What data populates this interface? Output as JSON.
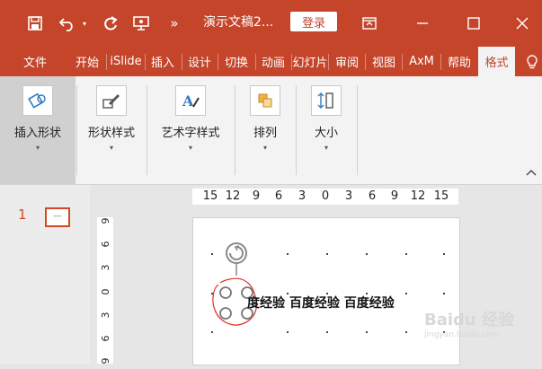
{
  "window": {
    "title": "演示文稿2...",
    "login_label": "登录",
    "overflow_label": "»"
  },
  "tabs": [
    {
      "label": "文件",
      "active": false
    },
    {
      "label": "开始",
      "active": false
    },
    {
      "label": "iSlide",
      "active": false
    },
    {
      "label": "插入",
      "active": false
    },
    {
      "label": "设计",
      "active": false
    },
    {
      "label": "切换",
      "active": false
    },
    {
      "label": "动画",
      "active": false
    },
    {
      "label": "幻灯片",
      "active": false
    },
    {
      "label": "审阅",
      "active": false
    },
    {
      "label": "视图",
      "active": false
    },
    {
      "label": "AxM",
      "active": false
    },
    {
      "label": "帮助",
      "active": false
    },
    {
      "label": "格式",
      "active": true
    }
  ],
  "ribbon": {
    "groups": [
      {
        "label": "插入形状",
        "icon": "insert-shape-icon",
        "selected": true
      },
      {
        "label": "形状样式",
        "icon": "shape-style-icon",
        "selected": false
      },
      {
        "label": "艺术字样式",
        "icon": "wordart-style-icon",
        "selected": false
      },
      {
        "label": "排列",
        "icon": "arrange-icon",
        "selected": false
      },
      {
        "label": "大小",
        "icon": "size-icon",
        "selected": false
      }
    ]
  },
  "thumbnails": {
    "slide_number": "1",
    "thumb_text": "---"
  },
  "ruler": {
    "horizontal": [
      "15",
      "12",
      "9",
      "6",
      "3",
      "0",
      "3",
      "6",
      "9",
      "12",
      "15"
    ],
    "vertical": [
      "9",
      "6",
      "3",
      "0",
      "3",
      "6",
      "9"
    ]
  },
  "slide": {
    "text": "度经验 百度经验 百度经验"
  },
  "watermark": {
    "text": "Baidu 经验",
    "url": "jingyan.baidu.com"
  },
  "colors": {
    "accent": "#c4452a",
    "active_tab_text": "#c4452a",
    "slide_number": "#d24726",
    "annotation": "#e0302a"
  }
}
